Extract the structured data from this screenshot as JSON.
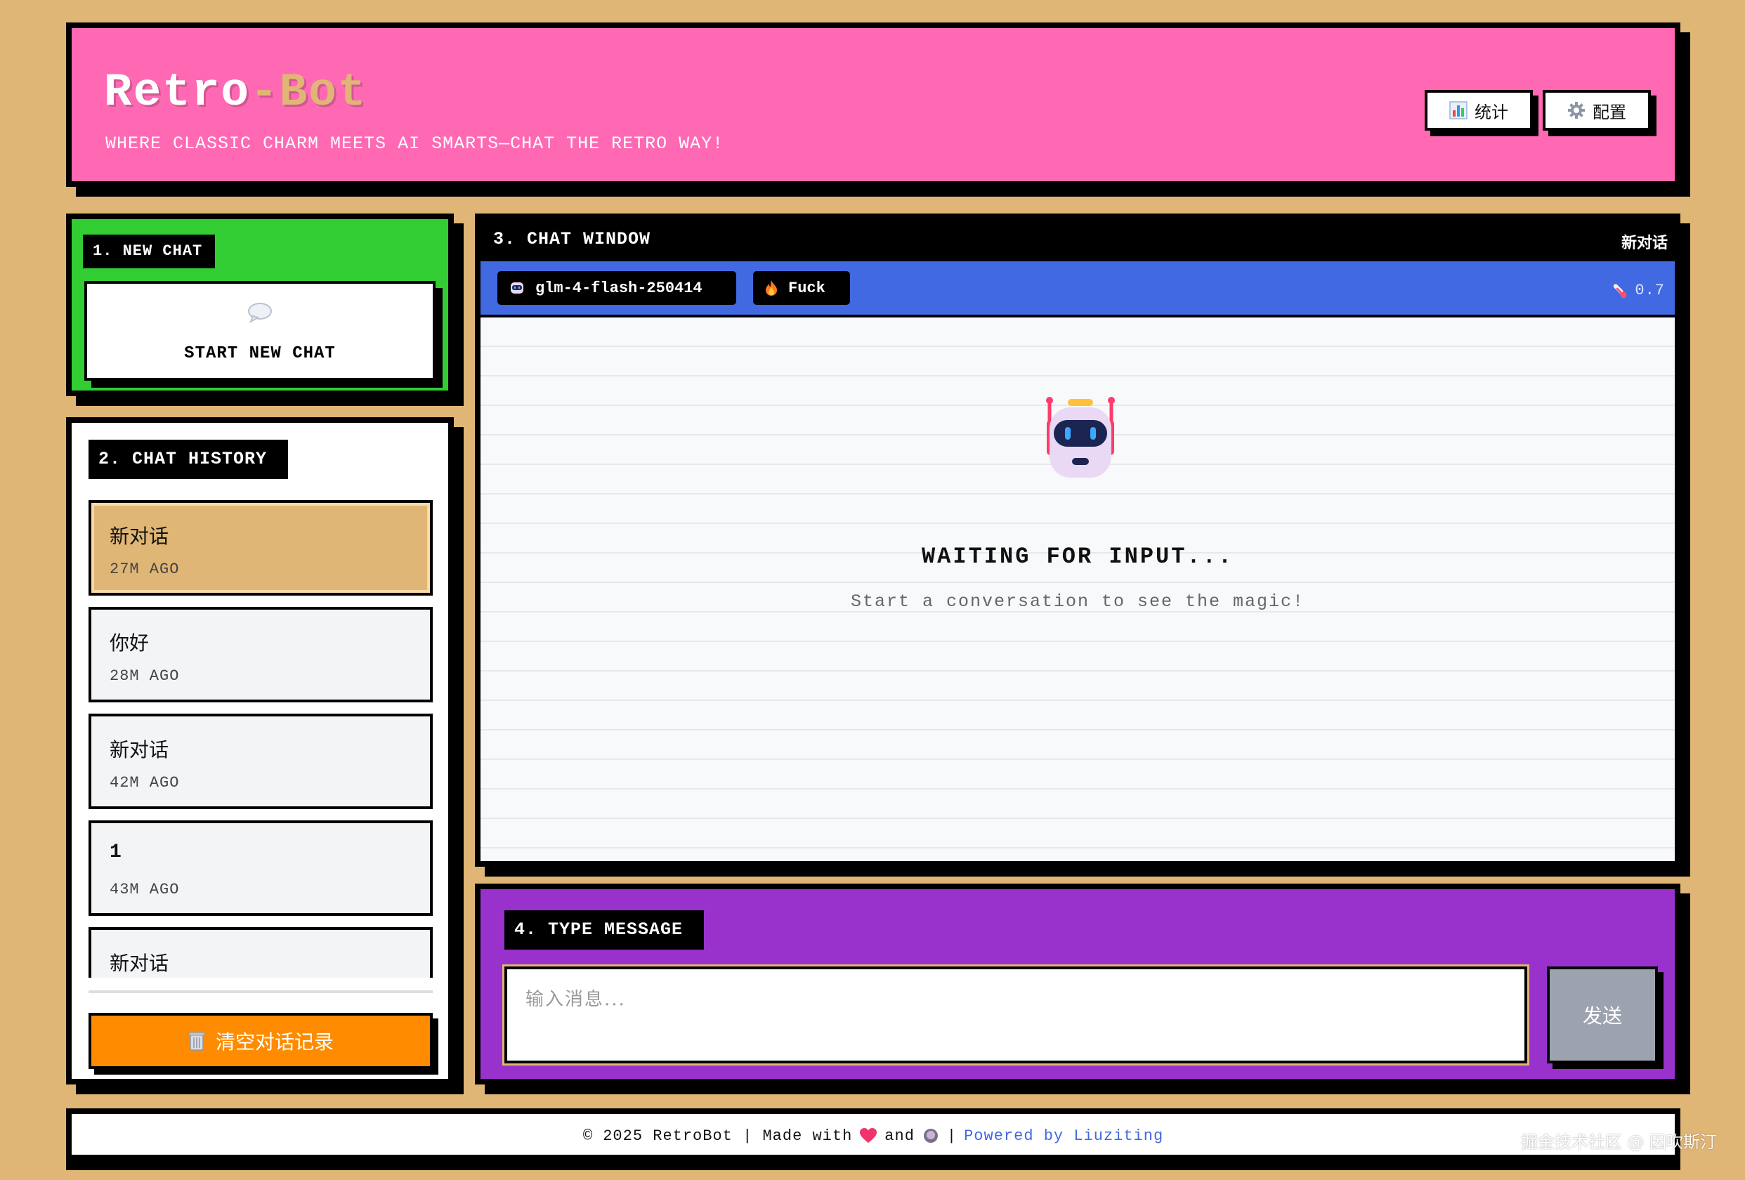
{
  "header": {
    "logo_main": "Retro",
    "logo_accent": "-Bot",
    "tagline": "WHERE CLASSIC CHARM MEETS AI SMARTS—CHAT THE RETRO WAY!",
    "stats_label": "统计",
    "config_label": "配置"
  },
  "new_chat": {
    "section_label": "1. NEW CHAT",
    "button_label": "START NEW CHAT"
  },
  "history": {
    "section_label": "2. CHAT HISTORY",
    "items": [
      {
        "title": "新对话",
        "time": "27M AGO",
        "active": true
      },
      {
        "title": "你好",
        "time": "28M AGO"
      },
      {
        "title": "新对话",
        "time": "42M AGO"
      },
      {
        "title": "1",
        "time": "43M AGO"
      },
      {
        "title": "新对话",
        "time": ""
      }
    ],
    "clear_label": "清空对话记录"
  },
  "chat": {
    "section_label": "3. CHAT WINDOW",
    "conversation_title": "新对话",
    "model": "glm-4-flash-250414",
    "persona": "Fuck",
    "temperature": "0.7",
    "waiting_title": "WAITING FOR INPUT...",
    "waiting_sub": "Start a conversation to see the magic!"
  },
  "input": {
    "section_label": "4. TYPE MESSAGE",
    "placeholder": "输入消息...",
    "send_label": "发送"
  },
  "footer": {
    "copyright": "© 2025 RetroBot | Made with",
    "and": "and",
    "separator": "|",
    "powered": "Powered by Liuziting"
  },
  "watermark": "掘金技术社区 @ 因吹斯汀",
  "colors": {
    "background": "#e0b676",
    "header": "#ff69b4",
    "new_chat": "#32cd32",
    "model_bar": "#4169e1",
    "input_panel": "#9932cc",
    "clear_button": "#ff8c00"
  }
}
